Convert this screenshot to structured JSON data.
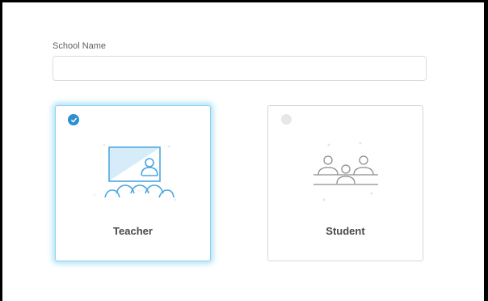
{
  "form": {
    "school_name_label": "School Name",
    "school_name_value": "",
    "school_name_placeholder": ""
  },
  "roles": [
    {
      "label": "Teacher",
      "selected": true,
      "icon": "classroom-teacher-icon"
    },
    {
      "label": "Student",
      "selected": false,
      "icon": "students-at-desk-icon"
    }
  ],
  "colors": {
    "accent": "#2e8fcf",
    "selected_glow": "#8cd3f1",
    "icon_stroke_blue": "#4aa6df",
    "icon_stroke_gray": "#8c8c8c"
  }
}
